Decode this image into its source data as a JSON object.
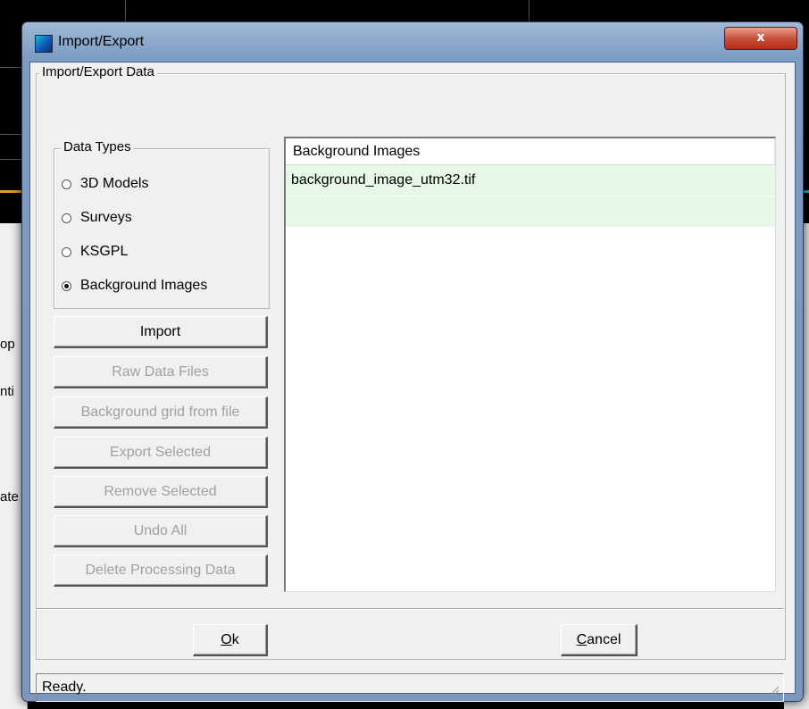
{
  "background": {
    "partial_texts": [
      "op",
      "nti",
      "ate"
    ]
  },
  "dialog": {
    "title": "Import/Export",
    "close_label": "x",
    "group_title": "Import/Export Data",
    "data_types": {
      "title": "Data Types",
      "options": [
        {
          "label": "3D Models",
          "checked": false
        },
        {
          "label": "Surveys",
          "checked": false
        },
        {
          "label": "KSGPL",
          "checked": false
        },
        {
          "label": "Background Images",
          "checked": true
        }
      ]
    },
    "buttons": [
      {
        "label": "Import",
        "enabled": true
      },
      {
        "label": "Raw Data Files",
        "enabled": false
      },
      {
        "label": "Background grid from file",
        "enabled": false
      },
      {
        "label": "Export Selected",
        "enabled": false
      },
      {
        "label": "Remove Selected",
        "enabled": false
      },
      {
        "label": "Undo All",
        "enabled": false
      },
      {
        "label": "Delete Processing Data",
        "enabled": false
      }
    ],
    "list": {
      "header": "Background Images",
      "rows": [
        "background_image_utm32.tif",
        ""
      ]
    },
    "ok": {
      "accel": "O",
      "rest": "k"
    },
    "cancel": {
      "accel": "C",
      "rest": "ancel"
    },
    "status": "Ready."
  }
}
